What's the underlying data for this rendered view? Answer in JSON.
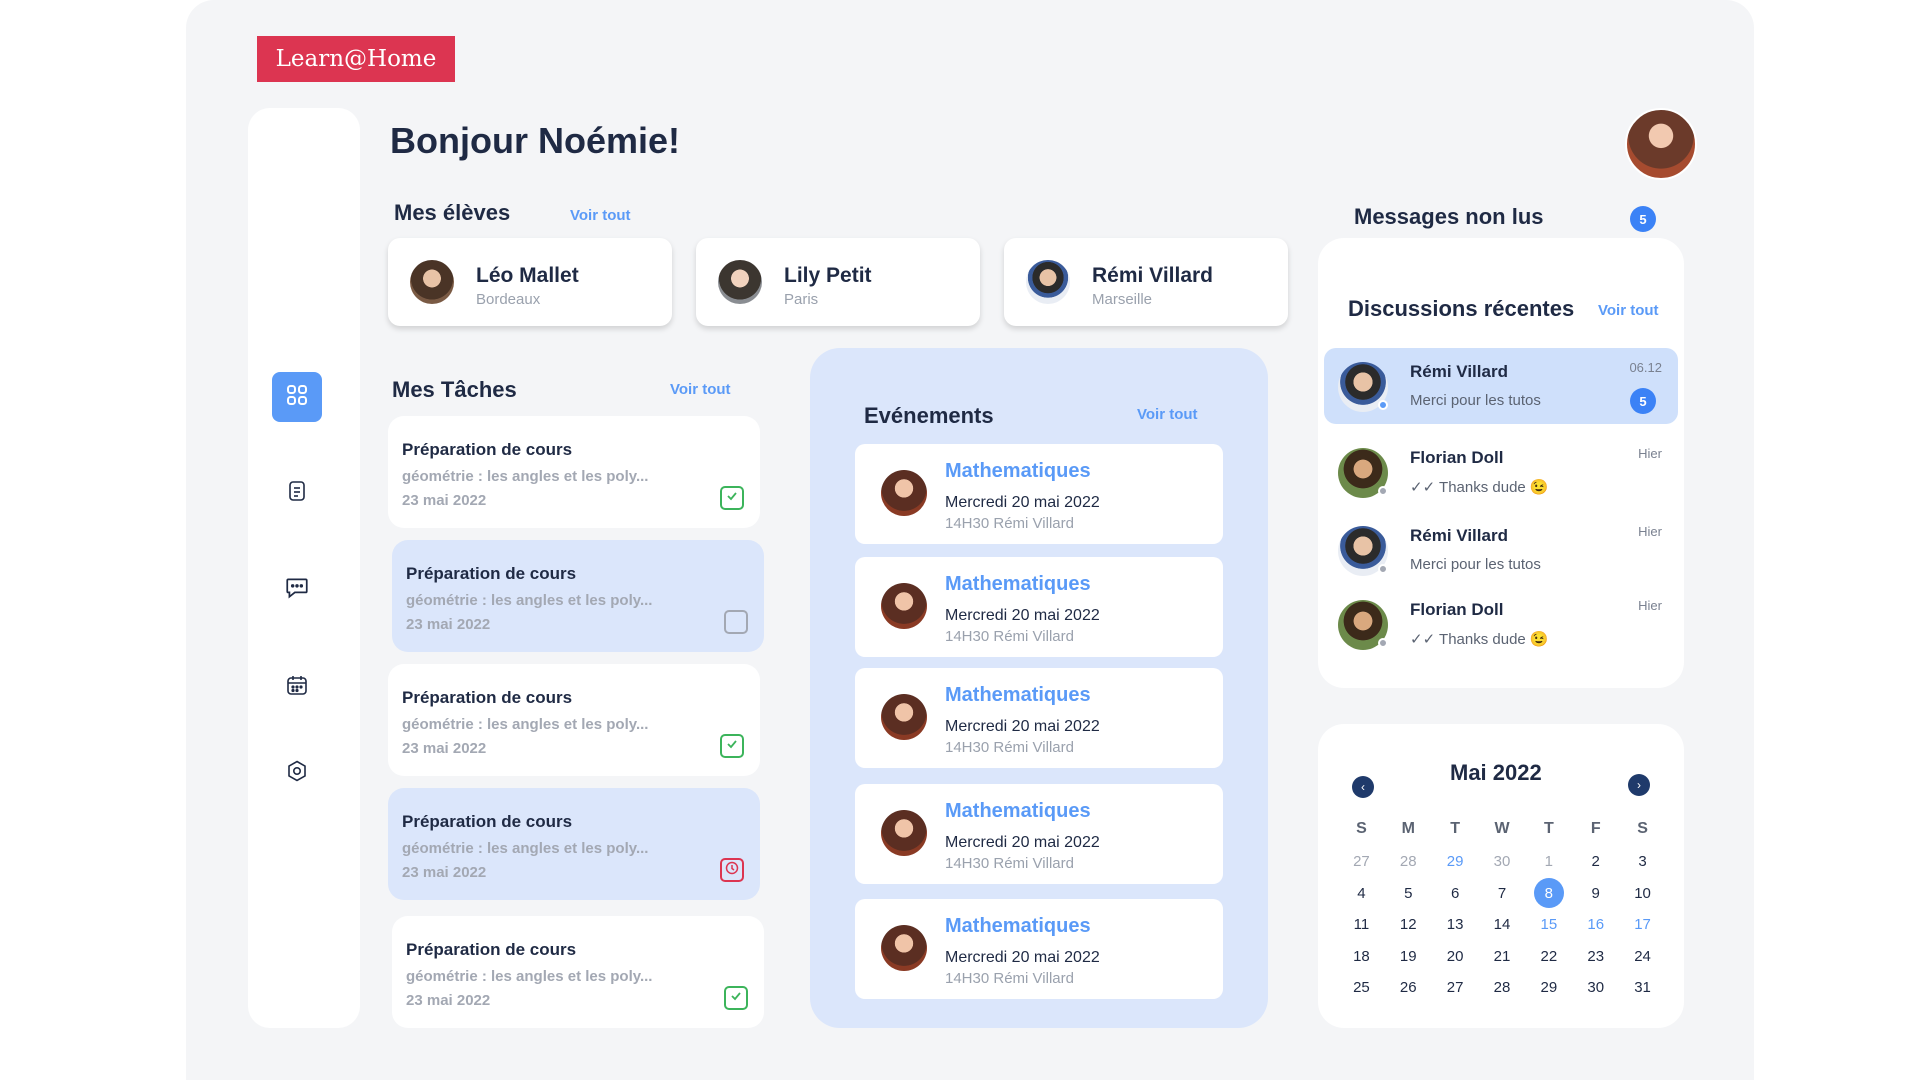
{
  "brand": "Learn@Home",
  "greeting": "Bonjour Noémie!",
  "students_section": {
    "title": "Mes élèves",
    "voir_tout": "Voir tout",
    "items": [
      {
        "name": "Léo Mallet",
        "city": "Bordeaux"
      },
      {
        "name": "Lily Petit",
        "city": "Paris"
      },
      {
        "name": "Rémi Villard",
        "city": "Marseille"
      }
    ]
  },
  "tasks_section": {
    "title": "Mes Tâches",
    "voir_tout": "Voir tout",
    "items": [
      {
        "title": "Préparation de cours",
        "desc": "géométrie : les angles et  les poly...",
        "date": "23 mai 2022",
        "status": "done"
      },
      {
        "title": "Préparation de cours",
        "desc": "géométrie : les angles et  les poly...",
        "date": "23 mai 2022",
        "status": "todo"
      },
      {
        "title": "Préparation de cours",
        "desc": "géométrie : les angles et  les poly...",
        "date": "23 mai 2022",
        "status": "done"
      },
      {
        "title": "Préparation de cours",
        "desc": "géométrie : les angles et  les poly...",
        "date": "23 mai 2022",
        "status": "late"
      },
      {
        "title": "Préparation de cours",
        "desc": "géométrie : les angles et  les poly...",
        "date": "23 mai 2022",
        "status": "done"
      }
    ]
  },
  "events_section": {
    "title": "Evénements",
    "voir_tout": "Voir tout",
    "items": [
      {
        "subject": "Mathematiques",
        "date": "Mercredi  20 mai 2022",
        "time": "14H30 Rémi Villard"
      },
      {
        "subject": "Mathematiques",
        "date": "Mercredi  20 mai 2022",
        "time": "14H30 Rémi Villard"
      },
      {
        "subject": "Mathematiques",
        "date": "Mercredi  20 mai 2022",
        "time": "14H30 Rémi Villard"
      },
      {
        "subject": "Mathematiques",
        "date": "Mercredi  20 mai 2022",
        "time": "14H30 Rémi Villard"
      },
      {
        "subject": "Mathematiques",
        "date": "Mercredi  20 mai 2022",
        "time": "14H30 Rémi Villard"
      }
    ]
  },
  "messages": {
    "title": "Messages non lus",
    "unread_count": "5",
    "recent_title": "Discussions récentes",
    "voir_tout": "Voir tout",
    "items": [
      {
        "name": "Rémi Villard",
        "text": "Merci pour les tutos",
        "time": "06.12",
        "badge": "5"
      },
      {
        "name": "Florian Doll",
        "text": "✓✓ Thanks dude 😉",
        "time": "Hier"
      },
      {
        "name": "Rémi Villard",
        "text": "Merci pour les tutos",
        "time": "Hier"
      },
      {
        "name": "Florian Doll",
        "text": "✓✓ Thanks dude 😉",
        "time": "Hier"
      }
    ]
  },
  "calendar": {
    "title": "Mai 2022",
    "prev": "‹",
    "next": "›",
    "weekdays": [
      "S",
      "M",
      "T",
      "W",
      "T",
      "F",
      "S"
    ],
    "days": [
      [
        "27",
        "28",
        "29",
        "30",
        "1",
        "2",
        "3"
      ],
      [
        "4",
        "5",
        "6",
        "7",
        "8",
        "9",
        "10"
      ],
      [
        "11",
        "12",
        "13",
        "14",
        "15",
        "16",
        "17"
      ],
      [
        "18",
        "19",
        "20",
        "21",
        "22",
        "23",
        "24"
      ],
      [
        "25",
        "26",
        "27",
        "28",
        "29",
        "30",
        "31"
      ]
    ],
    "selected": "8"
  },
  "nav": [
    "dashboard-icon",
    "document-icon",
    "chat-icon",
    "calendar-icon",
    "settings-icon"
  ],
  "colors": {
    "brand": "#dc3551",
    "accent": "#5a9af7",
    "panel_blue": "#dbe6fb"
  }
}
